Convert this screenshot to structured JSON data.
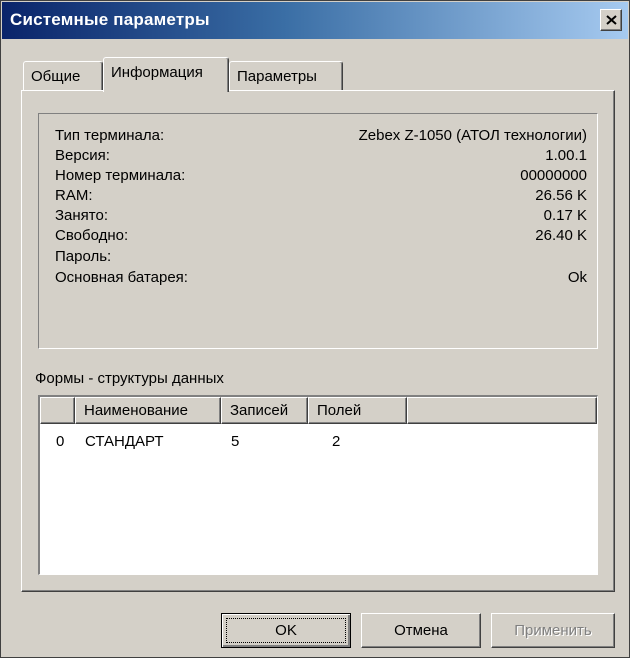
{
  "window": {
    "title": "Системные параметры"
  },
  "tabs": [
    {
      "label": "Общие"
    },
    {
      "label": "Информация"
    },
    {
      "label": "Параметры"
    }
  ],
  "info": [
    {
      "label": "Тип терминала:",
      "value": "Zebex Z-1050 (АТОЛ технологии)"
    },
    {
      "label": "Версия:",
      "value": "1.00.1"
    },
    {
      "label": "Номер терминала:",
      "value": "00000000"
    },
    {
      "label": "RAM:",
      "value": "26.56 K"
    },
    {
      "label": "Занято:",
      "value": "0.17 K"
    },
    {
      "label": "Свободно:",
      "value": "26.40 K"
    },
    {
      "label": "Пароль:",
      "value": ""
    },
    {
      "label": "Основная батарея:",
      "value": "Ok"
    }
  ],
  "forms": {
    "label": "Формы - структуры данных",
    "columns": [
      "",
      "Наименование",
      "Записей",
      "Полей"
    ],
    "rows": [
      [
        "0",
        "СТАНДАРТ",
        "5",
        "2"
      ]
    ]
  },
  "buttons": {
    "ok": "OK",
    "cancel": "Отмена",
    "apply": "Применить"
  }
}
